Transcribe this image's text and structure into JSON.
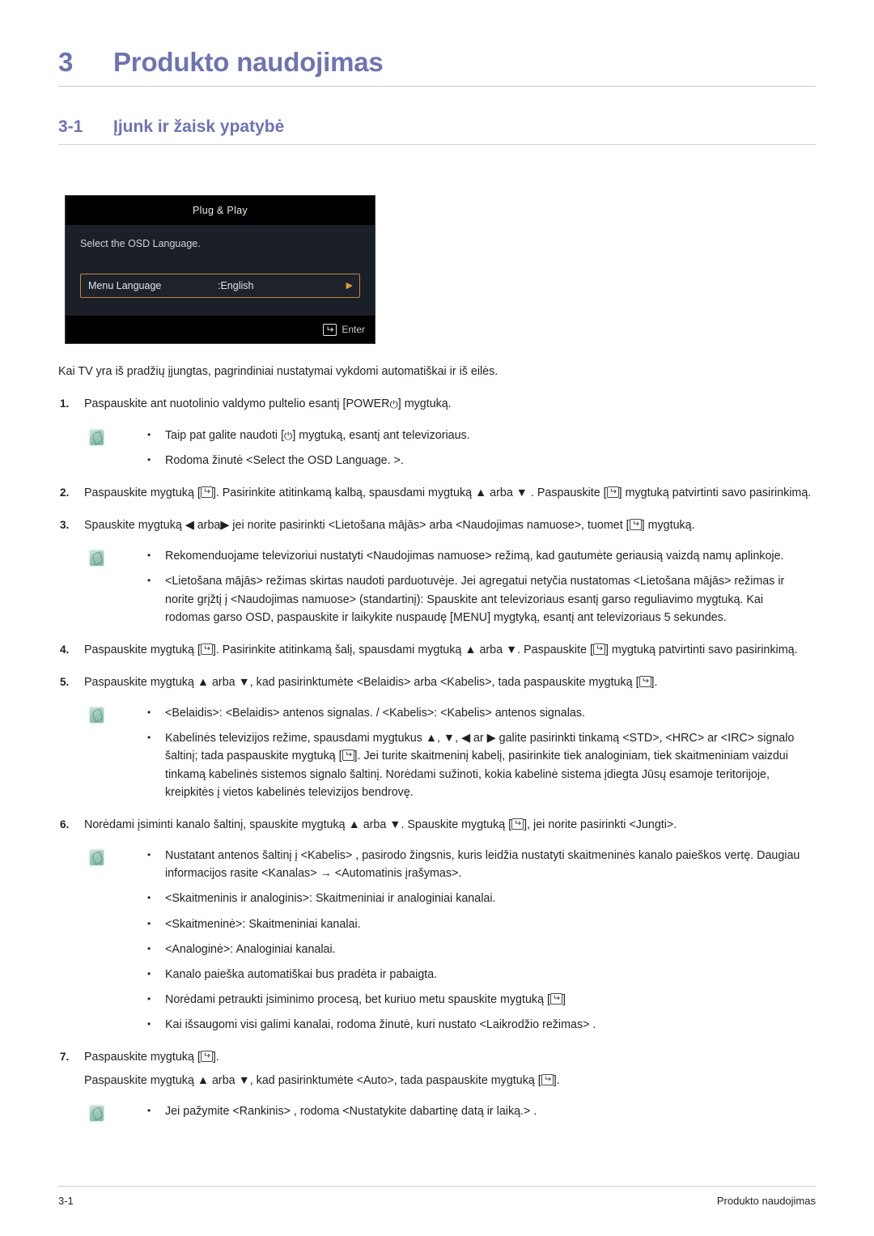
{
  "chapter": {
    "number": "3",
    "title": "Produkto naudojimas"
  },
  "section": {
    "number": "3-1",
    "title": "Įjunk ir žaisk ypatybė"
  },
  "osd": {
    "title": "Plug & Play",
    "prompt": "Select the OSD Language.",
    "row_label": "Menu Language",
    "row_value": ":English",
    "row_arrow": "▶",
    "enter_label": "Enter",
    "highlight_color": "#c08a3e",
    "background_color": "#1b1f28",
    "titlebar_color": "#000000"
  },
  "intro": "Kai TV yra iš pradžių įjungtas, pagrindiniai nustatymai vykdomi automatiškai ir iš eilės.",
  "steps": [
    {
      "num": "1.",
      "text_before": "Paspauskite ant nuotolinio valdymo pultelio esantį [POWER",
      "power_glyph": "⏻",
      "text_after": "] mygtuką."
    },
    {
      "num": "2.",
      "parts": [
        "Paspauskite mygtuką [",
        "]. Pasirinkite atitinkamą kalbą, spausdami mygtuką ▲ arba ▼ . Paspauskite [",
        "] mygtuką patvirtinti savo pasirinkimą."
      ]
    },
    {
      "num": "3.",
      "parts": [
        "Spauskite mygtuką ◀ arba▶ jei norite pasirinkti <Lietošana mājās> arba <Naudojimas namuose>, tuomet [",
        "] mygtuką."
      ]
    },
    {
      "num": "4.",
      "parts": [
        "Paspauskite mygtuką [",
        "]. Pasirinkite atitinkamą šalį, spausdami mygtuką ▲ arba ▼. Paspauskite [",
        "] mygtuką patvirtinti savo pasirinkimą."
      ]
    },
    {
      "num": "5.",
      "parts": [
        "Paspauskite mygtuką ▲ arba ▼, kad pasirinktumėte <Belaidis> arba <Kabelis>, tada paspauskite mygtuką [",
        "]."
      ]
    },
    {
      "num": "6.",
      "parts": [
        "Norėdami įsiminti kanalo šaltinį, spauskite mygtuką ▲ arba ▼. Spauskite mygtuką [",
        "], jei norite pasirinkti <Jungti>."
      ]
    },
    {
      "num": "7.",
      "parts": [
        "Paspauskite mygtuką [",
        "]."
      ],
      "sub_parts": [
        "Paspauskite mygtuką ▲ arba ▼, kad pasirinktumėte <Auto>, tada paspauskite mygtuką [",
        "]."
      ]
    }
  ],
  "notes": {
    "after_step1": [
      {
        "pre": "Taip pat galite naudoti [",
        "glyph": "⏻",
        "post": "] mygtuką, esantį ant televizoriaus."
      },
      {
        "pre": "Rodoma žinutė <Select the OSD Language. >.",
        "glyph": "",
        "post": ""
      }
    ],
    "after_step3": [
      {
        "pre": "Rekomenduojame televizoriui nustatyti <Naudojimas namuose> režimą, kad gautumėte geriausią vaizdą namų aplinkoje.",
        "glyph": "",
        "post": ""
      },
      {
        "pre": "<Lietošana mājās> režimas skirtas naudoti parduotuvėje. Jei agregatui netyčia nustatomas <Lietošana mājās> režimas ir norite grįžtį į <Naudojimas namuose> (standartinį): Spauskite ant televizoriaus esantį garso reguliavimo mygtuką. Kai rodomas garso OSD, paspauskite ir laikykite nuspaudę [MENU] mygtyką, esantį ant televizoriaus 5 sekundes.",
        "glyph": "",
        "post": ""
      }
    ],
    "after_step5": [
      {
        "pre": "<Belaidis>: <Belaidis> antenos signalas. / <Kabelis>: <Kabelis> antenos signalas.",
        "glyph": "",
        "post": ""
      },
      {
        "pre": "Kabelinės televizijos režime, spausdami mygtukus ▲, ▼, ◀ ar ▶ galite pasirinkti tinkamą <STD>, <HRC> ar <IRC> signalo šaltinį; tada paspauskite mygtuką [",
        "glyph": "key",
        "post": "]. Jei turite skaitmeninį kabelį, pasirinkite tiek analoginiam, tiek skaitmeniniam vaizdui tinkamą kabelinės sistemos signalo šaltinį. Norėdami sužinoti, kokia kabelinė sistema įdiegta Jūsų esamoje teritorijoje, kreipkitės į vietos kabelinės televizijos bendrovę."
      }
    ],
    "after_step6": [
      {
        "pre": "Nustatant antenos šaltinį į <Kabelis> , pasirodo žingsnis, kuris leidžia nustatyti skaitmeninės kanalo paieškos vertę. Daugiau informacijos rasite <Kanalas> → <Automatinis įrašymas>.",
        "glyph": "",
        "post": ""
      },
      {
        "pre": "<Skaitmeninis ir analoginis>: Skaitmeniniai ir analoginiai kanalai.",
        "glyph": "",
        "post": ""
      },
      {
        "pre": "<Skaitmeninė>: Skaitmeniniai kanalai.",
        "glyph": "",
        "post": ""
      },
      {
        "pre": "<Analoginė>: Analoginiai kanalai.",
        "glyph": "",
        "post": ""
      },
      {
        "pre": "Kanalo paieška automatiškai bus pradėta ir pabaigta.",
        "glyph": "",
        "post": ""
      },
      {
        "pre": "Norėdami petraukti įsiminimo procesą, bet kuriuo metu spauskite mygtuką [",
        "glyph": "key",
        "post": "]"
      },
      {
        "pre": "Kai išsaugomi visi galimi kanalai, rodoma žinutė, kuri nustato <Laikrodžio režimas> .",
        "glyph": "",
        "post": ""
      }
    ],
    "after_step7": [
      {
        "pre": "Jei pažymite <Rankinis> , rodoma <Nustatykite dabartinę datą ir laiką.> .",
        "glyph": "",
        "post": ""
      }
    ]
  },
  "footer": {
    "left": "3-1",
    "right": "Produkto naudojimas"
  },
  "bullet_char": "•"
}
